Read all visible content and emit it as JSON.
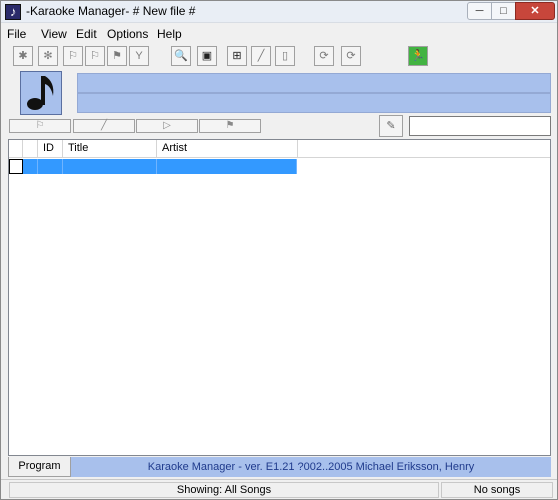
{
  "window": {
    "title": "-Karaoke Manager- # New file #"
  },
  "menu": {
    "items": [
      "File",
      "View",
      "Edit",
      "Options",
      "Help"
    ]
  },
  "toolbar": {
    "buttons": [
      {
        "icon": "star-icon",
        "glyph": "✱"
      },
      {
        "icon": "asterisk-icon",
        "glyph": "✻"
      },
      {
        "icon": "flag-icon",
        "glyph": "⚐"
      },
      {
        "icon": "flag-box-icon",
        "glyph": "⚐"
      },
      {
        "icon": "flag-check-icon",
        "glyph": "⚑"
      },
      {
        "icon": "fork-icon",
        "glyph": "Y"
      },
      {
        "icon": "magnifier-icon",
        "glyph": "🔍"
      },
      {
        "icon": "monitor-icon",
        "glyph": "▣"
      },
      {
        "icon": "new-page-icon",
        "glyph": "⊞"
      },
      {
        "icon": "pen-icon",
        "glyph": "╱"
      },
      {
        "icon": "page-icon",
        "glyph": "▯"
      },
      {
        "icon": "refresh-icon",
        "glyph": "⟳"
      },
      {
        "icon": "refresh-page-icon",
        "glyph": "⟳"
      },
      {
        "icon": "running-man-icon",
        "glyph": "🏃"
      }
    ],
    "accent": "#42b342"
  },
  "info": {
    "accent": "#a8c0ec"
  },
  "filter": {
    "buttons": [
      "⚐",
      "╱",
      "▷",
      "⚑"
    ],
    "search_value": ""
  },
  "list": {
    "columns": [
      "",
      "ID",
      "Title",
      "Artist"
    ],
    "selection_color": "#3399ff"
  },
  "bottom": {
    "program_info_tab": "Program Info",
    "version_text": "Karaoke Manager - ver. E1.21 ?002..2005 Michael Eriksson, Henry"
  },
  "status": {
    "showing": "Showing: All Songs",
    "count": "No songs"
  }
}
